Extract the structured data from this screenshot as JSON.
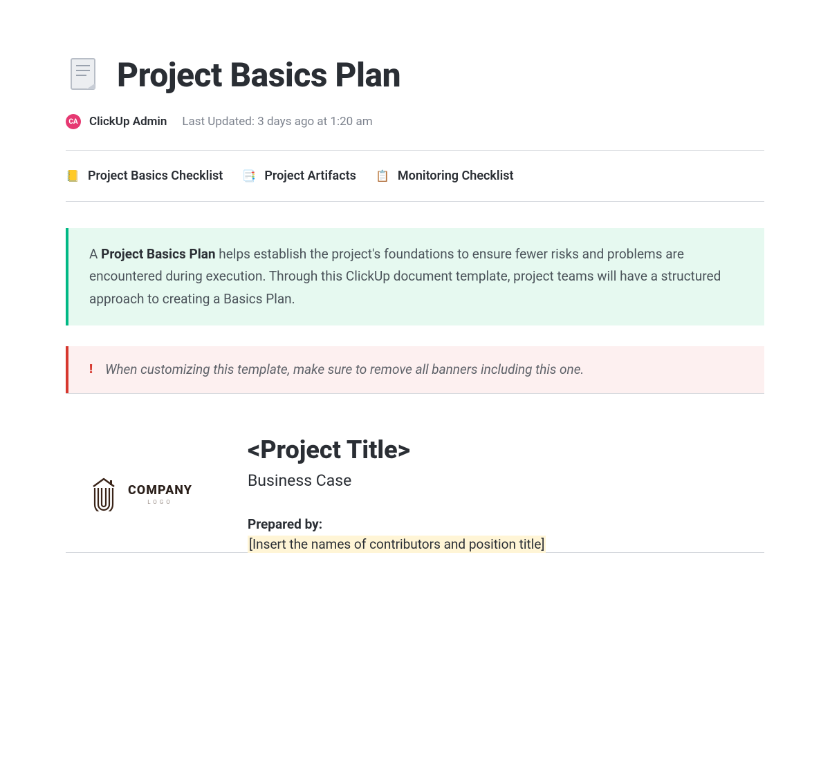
{
  "header": {
    "title": "Project Basics Plan",
    "avatar_initials": "CA",
    "author": "ClickUp Admin",
    "updated": "Last Updated: 3 days ago at 1:20 am"
  },
  "tabs": [
    {
      "icon": "📒",
      "label": "Project Basics Checklist"
    },
    {
      "icon": "📑",
      "label": "Project Artifacts"
    },
    {
      "icon": "📋",
      "label": "Monitoring Checklist"
    }
  ],
  "banner_green": {
    "prefix": "A ",
    "bold": "Project Basics Plan",
    "rest": " helps establish the project's foundations to ensure fewer risks and problems are encountered during execution. Through this ClickUp document template, project teams will have a structured approach to creating a Basics Plan."
  },
  "banner_red": {
    "exclaim": "!",
    "text": "When customizing this template, make sure to remove all banners including this one."
  },
  "cover": {
    "logo_text": "COMPANY",
    "logo_sub": "LOGO",
    "project_title": "<Project Title>",
    "subtitle": "Business Case",
    "prepared_label": "Prepared by:",
    "prepared_placeholder": "[Insert the names of contributors and position title]"
  }
}
